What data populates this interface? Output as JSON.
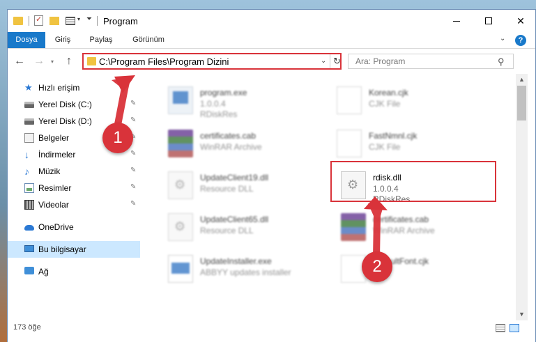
{
  "window": {
    "title": "Program"
  },
  "ribbon": {
    "tabs": [
      {
        "label": "Dosya",
        "active": true
      },
      {
        "label": "Giriş"
      },
      {
        "label": "Paylaş"
      },
      {
        "label": "Görünüm"
      }
    ],
    "help": "?"
  },
  "navigation": {
    "address": "C:\\Program Files\\Program Dizini",
    "search_placeholder": "Ara: Program"
  },
  "sidebar": {
    "items": [
      {
        "label": "Hızlı erişim",
        "icon": "star-icon"
      },
      {
        "label": "Yerel Disk (C:)",
        "icon": "disk-icon",
        "pinned": true
      },
      {
        "label": "Yerel Disk (D:)",
        "icon": "disk-icon",
        "pinned": true
      },
      {
        "label": "Belgeler",
        "icon": "documents-icon",
        "pinned": true
      },
      {
        "label": "İndirmeler",
        "icon": "download-icon",
        "pinned": true
      },
      {
        "label": "Müzik",
        "icon": "music-icon",
        "pinned": true
      },
      {
        "label": "Resimler",
        "icon": "pictures-icon",
        "pinned": true
      },
      {
        "label": "Videolar",
        "icon": "videos-icon",
        "pinned": true
      },
      {
        "label": "OneDrive",
        "icon": "cloud-icon"
      },
      {
        "label": "Bu bilgisayar",
        "icon": "computer-icon",
        "selected": true
      },
      {
        "label": "Ağ",
        "icon": "network-icon"
      }
    ]
  },
  "files": [
    {
      "name": "program.exe",
      "line1": "1.0.0.4",
      "line2": "RDiskRes",
      "type": "exe"
    },
    {
      "name": "Korean.cjk",
      "line1": "CJK File",
      "line2": "",
      "type": "blank"
    },
    {
      "name": "certificates.cab",
      "line1": "WinRAR Archive",
      "line2": "",
      "type": "cab"
    },
    {
      "name": "FastNmnl.cjk",
      "line1": "CJK File",
      "line2": "",
      "type": "blank"
    },
    {
      "name": "UpdateClient19.dll",
      "line1": "Resource DLL",
      "line2": "",
      "type": "dll"
    },
    {
      "name": "rdisk.dll",
      "line1": "1.0.0.4",
      "line2": "RDiskRes",
      "type": "dll"
    },
    {
      "name": "UpdateClient65.dll",
      "line1": "Resource DLL",
      "line2": "",
      "type": "dll"
    },
    {
      "name": "certificates.cab",
      "line1": "WinRAR Archive",
      "line2": "",
      "type": "cab"
    },
    {
      "name": "UpdateInstaller.exe",
      "line1": "ABBYY updates installer",
      "line2": "",
      "type": "install"
    },
    {
      "name": "DefaultFont.cjk",
      "line1": "",
      "line2": "",
      "type": "blank"
    }
  ],
  "status": {
    "count": "173 öğe"
  },
  "annotations": {
    "step1": "1",
    "step2": "2"
  },
  "colors": {
    "accent": "#1979ca",
    "highlight": "#d9333a",
    "selected": "#cce8ff"
  }
}
